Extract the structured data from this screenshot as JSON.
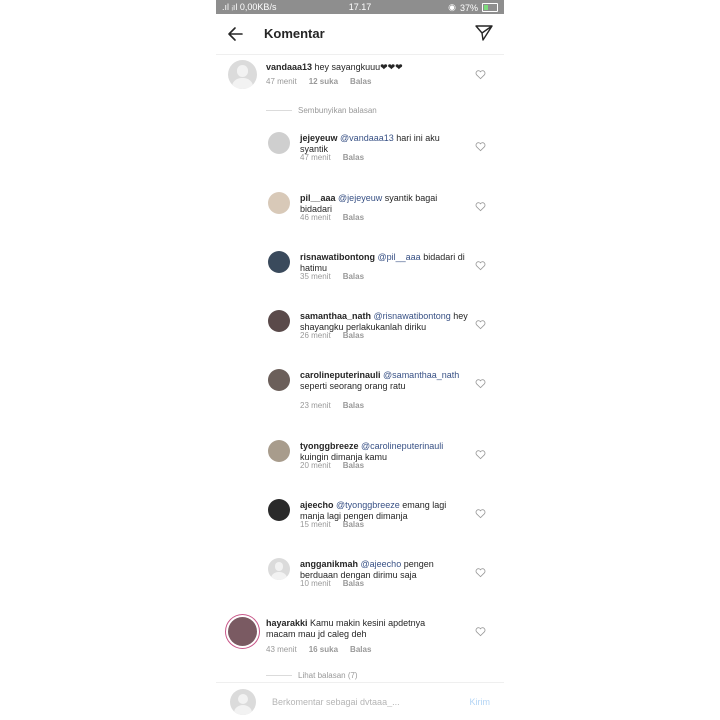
{
  "status_bar": {
    "left": ".ıl ᵢıl 0,00KB/s",
    "time": "17.17",
    "right": "37%",
    "battery_percent": 37
  },
  "header": {
    "title": "Komentar",
    "back_icon": "arrow-left-icon",
    "send_icon": "direct-send-icon"
  },
  "comments": [
    {
      "username": "vandaaa13",
      "text": " hey sayangkuuu❤❤❤",
      "time": "47 menit",
      "likes": "12 suka",
      "reply": "Balas"
    }
  ],
  "hide_replies_label": "Sembunyikan balasan",
  "replies": [
    {
      "username": "jejeyeuw",
      "mention": "@vandaaa13",
      "text": " hari ini aku syantik",
      "time": "47 menit",
      "reply": "Balas"
    },
    {
      "username": "pil__aaa",
      "mention": "@jejeyeuw",
      "text": " syantik bagai bidadari",
      "time": "46 menit",
      "reply": "Balas"
    },
    {
      "username": "risnawatibontong",
      "mention": "@pil__aaa",
      "text": " bidadari di hatimu",
      "time": "35 menit",
      "reply": "Balas"
    },
    {
      "username": "samanthaa_nath",
      "mention": "@risnawatibontong",
      "text": " hey shayangku perlakukanlah diriku",
      "time": "26 menit",
      "reply": "Balas"
    },
    {
      "username": "carolineputerinauli",
      "mention": "@samanthaa_nath",
      "text": " seperti seorang orang ratu",
      "time": "23 menit",
      "reply": "Balas"
    },
    {
      "username": "tyonggbreeze",
      "mention": "@carolineputerinauli",
      "text": " kuingin dimanja kamu",
      "time": "20 menit",
      "reply": "Balas"
    },
    {
      "username": "ajeecho",
      "mention": "@tyonggbreeze",
      "text": " emang lagi manja lagi pengen dimanja",
      "time": "15 menit",
      "reply": "Balas"
    },
    {
      "username": "angganikmah",
      "mention": "@ajeecho",
      "text": " pengen berduaan dengan dirimu saja",
      "time": "10 menit",
      "reply": "Balas"
    }
  ],
  "second_comment": {
    "username": "hayarakki",
    "text": " Kamu makin kesini apdetnya macam mau jd caleg deh",
    "time": "43 menit",
    "likes": "16 suka",
    "reply": "Balas"
  },
  "view_replies_label": "Lihat balasan (7)",
  "compose": {
    "placeholder": "Berkomentar sebagai dvtaaa_...",
    "send_label": "Kirim"
  },
  "colors": {
    "mention": "#385185",
    "meta": "#999999",
    "status_bar": "#8e8e8e",
    "send_disabled": "#b3d4f5"
  }
}
